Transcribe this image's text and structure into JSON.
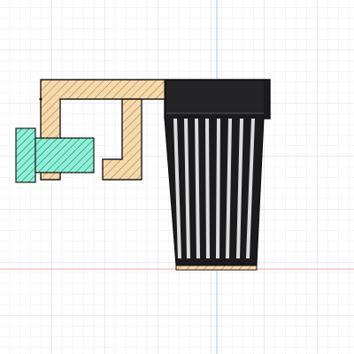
{
  "viewport": {
    "kind": "cad-section-view",
    "background": "#ffffff",
    "grid": {
      "minor_color": "#ececf2",
      "major_color": "#d4d6e4"
    },
    "axes": {
      "horizontal_color": "#f2a9a9",
      "vertical_color": "#a9c0ef"
    }
  },
  "parts": [
    {
      "name": "bracket",
      "section": "hatched",
      "fill": "#f3d9ab",
      "hatch_color": "#a9712e"
    },
    {
      "name": "thumb-screw",
      "section": "hatched",
      "fill": "#8ef0d6",
      "hatch_color": "#0f6a55"
    },
    {
      "name": "slotted-cup",
      "section": "solid",
      "fill": "#1b1b1d",
      "slot_color": "#dcdcdc"
    }
  ]
}
